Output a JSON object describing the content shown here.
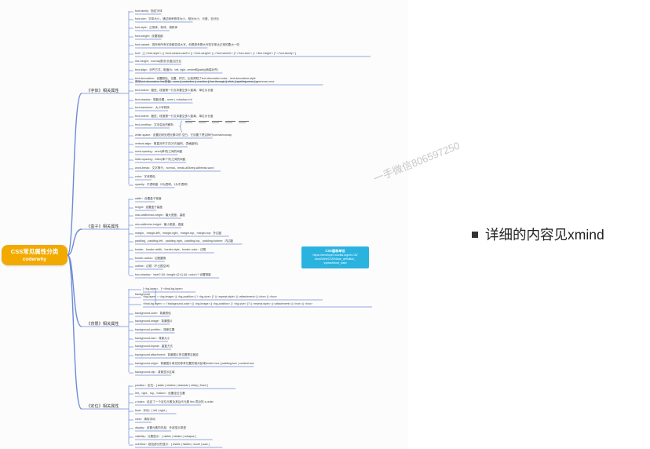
{
  "root": {
    "title": "CSS常见属性分类",
    "subtitle": "coderwhy"
  },
  "branches": [
    {
      "label": "《字体》相关属性",
      "items": [
        "font-family：指定字体",
        "font-size：字体大小，通过继承修改大小，相对大小，长度，百分比",
        "font-style：正常体、斜体、倾斜体",
        "font-weight：设置粗细",
        "font-variant：将所有所有字母都变成大写，但是原来是大写的字体比正常的要大一些",
        "font：[ [ <'font-style'> || <font-variant-css21> || <'font-weight'> || <'font-stretch'> ]? <'font-size'> [ / <'line-height'> ]? <'font-family'> ]",
        "line-height：normal|数字|长度|百分比",
        "text-align：对齐方式，取值为：left, right, center和justify(两端对齐)",
        "text-decoration：设置颜色，位置，样式，比较简短了text-decoration-color，text-decoration-style",
        "简写text-decoration-line的值：none || underline || overline || line-through || blink || spelling-error || grammar-error",
        "text-indent：缩进，段落第一行文本要空多少距离，单位为长度",
        "text-shadow：阴影设置，none | <shadow-t>#",
        "text-transform：大小写转换",
        "text-indent：缩进，段落第一行文本要空多少距离，单位为长度",
        "text-overflow：文本溢出的解析",
        "white-space：设置如何处理元素中的 空白，它设置了是否换行normal/nowrap",
        "vertical-align：垂直对齐方式(行内级别，表格级别)",
        "word-spacing：word(单词)之间的间距",
        "letter-spacing：letter(单个字)之间的间距",
        "word-break：文字换行，normal，break-all/keep-all/break-word",
        "color：字体颜色",
        "opacity：不透明度（0为透明，1为不透明）"
      ]
    },
    {
      "label": "《盒子》相关属性",
      "items": [
        "width：设置盒子宽度",
        "height：设置盒子高度",
        "max-width/max-height：最大宽度，高度",
        "min-width/min-height：最小宽度，高度",
        "margin、margin-left、margin-right、margin-top、margin-top：外边距",
        "padding、padding-left、padding-right、padding-top、padding-bottom：内边距",
        "border、border-width、border-style、border-color：边框",
        "border-radius：边框圆角",
        "outline：边框（不占据空间）",
        "box-shadow：inset? && <length>{2,4} && <color>? 设置阴影"
      ]
    },
    {
      "label": "《背景》相关属性",
      "items": [
        "[ <bg-layer>，]* <final-bg-layer>",
        "<bg-layer> = <bg-image> || <bg-position> [ / <bg-size> ]? || <repeat-style> || <attachment> || <box> || <box>",
        "<final-bg-layer> = <'background-color'> || <bg-image> || <bg-position> [ / <bg-size> ]? || <repeat-style> || <attachment> || <box> || <box>",
        "background-color：背景颜色",
        "background-image：背景图片",
        "background-position：背景位置",
        "background-size：背景大小",
        "background-repeat：重复方式",
        "background-attachment：背景图片的位置是否固定",
        "background-origin：背景图片填充的参考位置的相对区域border-box | padding-box | content-box",
        "background-clip：背景显示区域"
      ]
    },
    {
      "label": "《定位》相关属性",
      "items": [
        "position：定位：[ static | relative | absolute | sticky | fixed ]",
        "left、right、top、bottom：设置定位位置",
        "z-index：给定了一个定位元素及其后代元素 flex 项目的 z-order",
        "float：浮动：[ left | right ]",
        "clear：清除浮动",
        "display：设置元素的内部、外部显示类型",
        "visibility：元素显示：[ visible | hidden | collapse ]",
        "overflow：超出部分的显示：[ visible | hidden | scroll | auto ]"
      ]
    }
  ],
  "background_label": "background",
  "info_box": {
    "title": "CSS值和单位",
    "url": "https://developer.mozilla.org/zh-CN/\ndocs/Web/CSS/Value_definition_\nsyntax#host_main"
  },
  "watermark": "一手微信806597250",
  "note": "详细的内容见xmind",
  "colors": {
    "root_bg": "#f2a900",
    "lines": "#6c8bd6",
    "info_bg": "#2bb3e0"
  },
  "icons": {
    "bullet": "square-bullet-icon"
  }
}
